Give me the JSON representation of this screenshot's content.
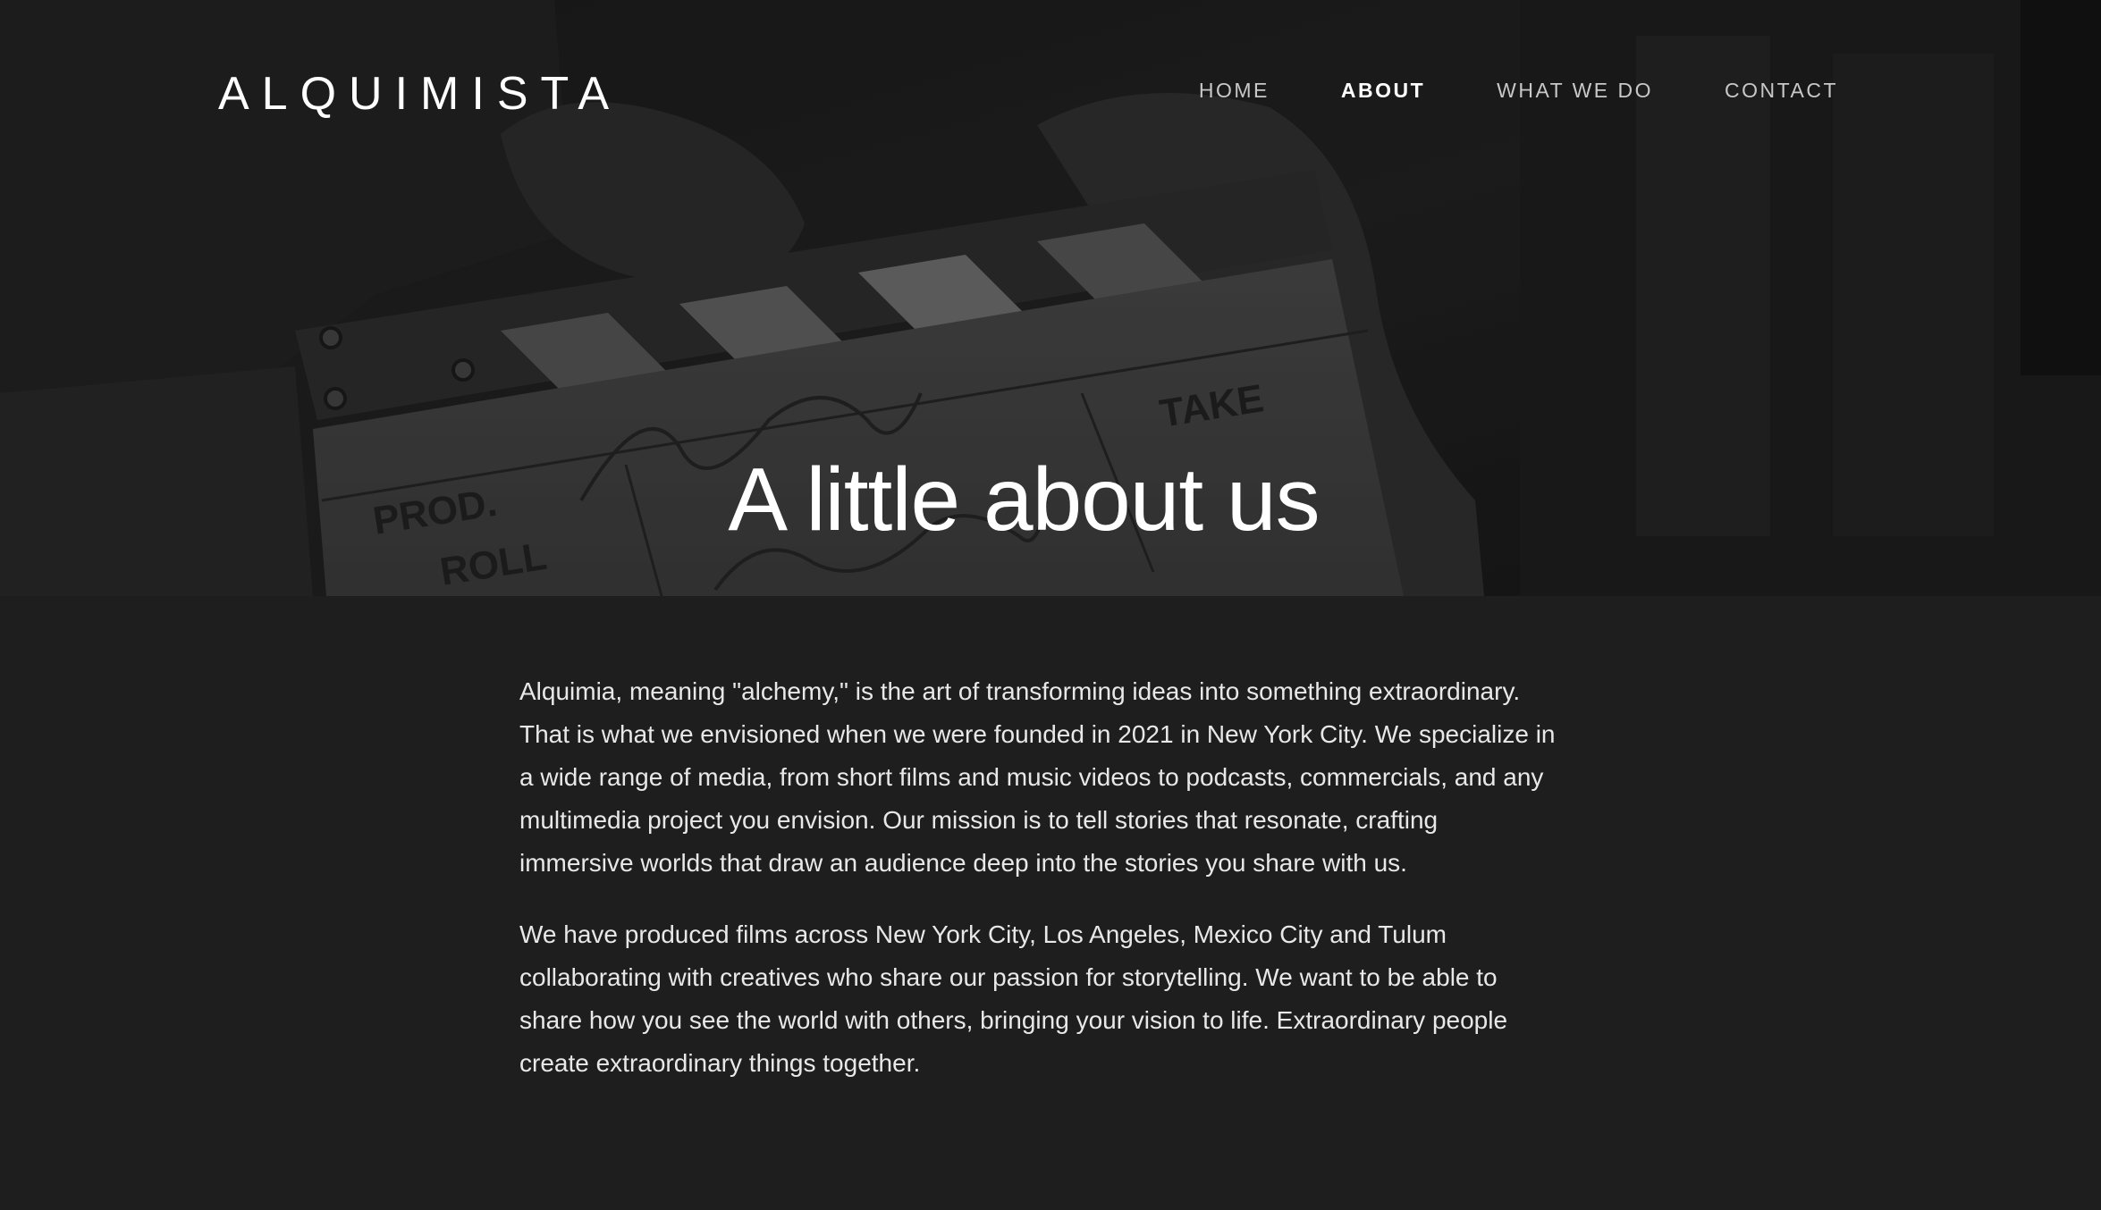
{
  "brand": {
    "logo": "ALQUIMISTA"
  },
  "nav": {
    "items": [
      {
        "label": "HOME",
        "active": false
      },
      {
        "label": "ABOUT",
        "active": true
      },
      {
        "label": "WHAT WE DO",
        "active": false
      },
      {
        "label": "CONTACT",
        "active": false
      }
    ]
  },
  "hero": {
    "title": "A little about us",
    "image_description_icon": "film-clapperboard-photo"
  },
  "about": {
    "paragraphs": [
      "Alquimia, meaning \"alchemy,\" is the art of transforming ideas into something extraordinary. That is what we envisioned when we were founded in 2021 in New York City. We specialize in a wide range of media, from short films and music videos to podcasts, commercials, and any multimedia project you envision. Our mission is to tell stories that resonate, crafting immersive worlds that draw an audience deep into the stories you share with us.",
      "We have produced films across New York City, Los Angeles, Mexico City and Tulum collaborating with creatives who share our passion for storytelling. We want to be able to share how you see the world with others, bringing your vision to life. Extraordinary people create extraordinary things together."
    ]
  },
  "colors": {
    "background": "#1e1e1e",
    "text": "#e8e8e8",
    "nav_inactive": "#c8c8c8",
    "nav_active": "#ffffff"
  }
}
